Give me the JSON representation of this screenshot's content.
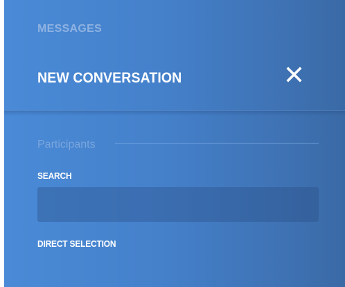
{
  "header": {
    "section_label": "MESSAGES",
    "title": "NEW CONVERSATION",
    "close_icon": "close-icon"
  },
  "participants": {
    "legend": "Participants",
    "search_label": "SEARCH",
    "search_value": "",
    "direct_selection_label": "DIRECT SELECTION"
  },
  "colors": {
    "panel_gradient_start": "#4a8ad6",
    "panel_gradient_end": "#3a6aa6",
    "title_text": "#ffffff",
    "muted_text": "#8fb3e2"
  }
}
